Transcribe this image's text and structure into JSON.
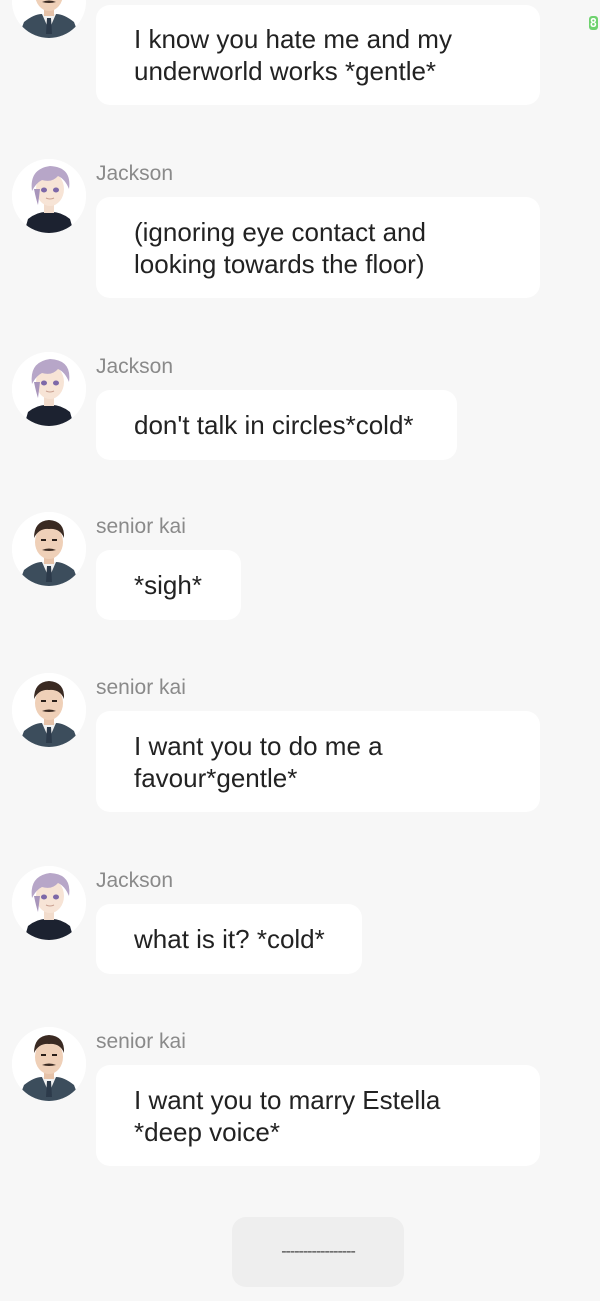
{
  "status_indicator": "8",
  "messages": [
    {
      "speaker": "",
      "avatar": "senior-kai-avatar",
      "text": "I know you hate me and my underworld works *gentle*"
    },
    {
      "speaker": "Jackson",
      "avatar": "jackson-avatar",
      "text": "(ignoring eye contact and looking towards the floor)"
    },
    {
      "speaker": "Jackson",
      "avatar": "jackson-avatar",
      "text": "don't talk in circles*cold*"
    },
    {
      "speaker": "senior kai",
      "avatar": "senior-kai-avatar",
      "text": "*sigh*"
    },
    {
      "speaker": "senior kai",
      "avatar": "senior-kai-avatar",
      "text": "I want you to do me a favour*gentle*"
    },
    {
      "speaker": "Jackson",
      "avatar": "jackson-avatar",
      "text": "what is it? *cold*"
    },
    {
      "speaker": "senior kai",
      "avatar": "senior-kai-avatar",
      "text": "I want you to marry Estella *deep voice*"
    }
  ],
  "continue_button": {
    "label": "-----------------"
  },
  "colors": {
    "background": "#f7f7f7",
    "bubble": "#ffffff",
    "speaker_name": "#8a8a8a",
    "message_text": "#222222",
    "continue_button": "#eeeeee"
  }
}
